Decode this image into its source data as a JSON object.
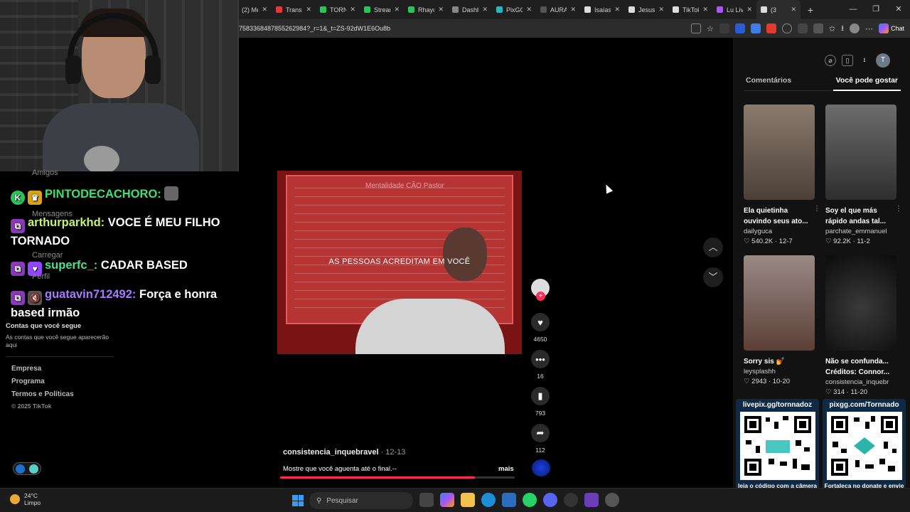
{
  "browser": {
    "tabs": [
      {
        "label": "(2) Me",
        "color": "#e33"
      },
      {
        "label": "Transm",
        "color": "#e33"
      },
      {
        "label": "TORNI",
        "color": "#28c65a"
      },
      {
        "label": "Stream",
        "color": "#28c65a"
      },
      {
        "label": "Rhaycl",
        "color": "#28c65a"
      },
      {
        "label": "Dashb",
        "color": "#888"
      },
      {
        "label": "PixGG",
        "color": "#2bb"
      },
      {
        "label": "AURA",
        "color": "#555"
      },
      {
        "label": "Isaías",
        "color": "#ddd"
      },
      {
        "label": "Jesus",
        "color": "#ddd"
      },
      {
        "label": "TikTok",
        "color": "#ddd"
      },
      {
        "label": "Lu Liv",
        "color": "#a5f"
      },
      {
        "label": "(3",
        "color": "#ddd"
      }
    ],
    "url": "7583368487855262984?_r=1&_t=ZS-92dW1E6Ou8b",
    "chat_label": "Chat",
    "window_buttons": [
      "—",
      "❐",
      "✕"
    ]
  },
  "overlay": {
    "faded_menu": {
      "friends": "Amigos",
      "messages": "Mensagens",
      "upload": "Carregar",
      "profile": "Perfil"
    },
    "chat": [
      {
        "badge": "K",
        "badge_color": "#28c65a",
        "name": "PINTODECACHORO:",
        "name_color": "#40e070",
        "text": ""
      },
      {
        "badge": "⧉",
        "badge_color": "#8a3ab9",
        "name": "arthurparkhd:",
        "name_color": "#c7f26a",
        "text": "VOCE É MEU FILHO TORNADO"
      },
      {
        "badge": "⧉",
        "badge_color": "#8a3ab9",
        "name": "superfc_:",
        "name_color": "#49e38a",
        "text": "CADAR BASED"
      },
      {
        "badge": "⧉",
        "badge_color": "#8a3ab9",
        "name": "guatavin712492:",
        "name_color": "#a77aff",
        "text": "Força e honra based irmão"
      }
    ],
    "following_title": "Contas que você segue",
    "following_empty": "As contas que você segue aparecerão aqui",
    "links": [
      "Empresa",
      "Programa",
      "Termos e Políticas"
    ],
    "copyright": "© 2025 TikTok"
  },
  "video": {
    "whiteboard_title": "Mentalidade CÃO Pastor",
    "caption": "AS PESSOAS ACREDITAM EM VOCÊ",
    "author": "consistencia_inquebravel",
    "date": "· 12-13",
    "description": "Mostre que você aguenta até o final.--",
    "more": "mais",
    "progress": 0.83,
    "likes": "4650",
    "comments": "16",
    "saves": "793",
    "shares": "112"
  },
  "panel": {
    "tabs": [
      "Comentários",
      "Você pode gostar"
    ],
    "active_tab": 1,
    "avatar_letter": "T",
    "cards": [
      {
        "title": "Ela quietinha ouvindo seus ato...",
        "author": "dailyguca",
        "stats": "♡ 540.2K · 12-7",
        "bg": "#6b5a4c"
      },
      {
        "title": "Soy el que más rápido andas tal...",
        "author": "parchate_emmanuel",
        "stats": "♡ 92.2K · 11-2",
        "bg": "#4d4d4d"
      },
      {
        "title": "Sorry sis 💅",
        "author": "leysplashh",
        "stats": "♡ 2943 · 10-20",
        "bg": "#6a4d44"
      },
      {
        "title": "Não se confunda... Créditos: Connor...",
        "author": "consistencia_inquebr",
        "stats": "♡ 314 · 11-20",
        "bg": "#151515"
      }
    ],
    "qr": [
      {
        "header": "livepix.gg/tornnadoz",
        "footer": "leia o código com a câmera do celular."
      },
      {
        "header": "pixgg.com/Tornnado",
        "footer": "Fortaleça no donate e envie sua mensagem!"
      }
    ]
  },
  "taskbar": {
    "temp": "24°C",
    "condition": "Limpo",
    "search": "Pesquisar"
  }
}
